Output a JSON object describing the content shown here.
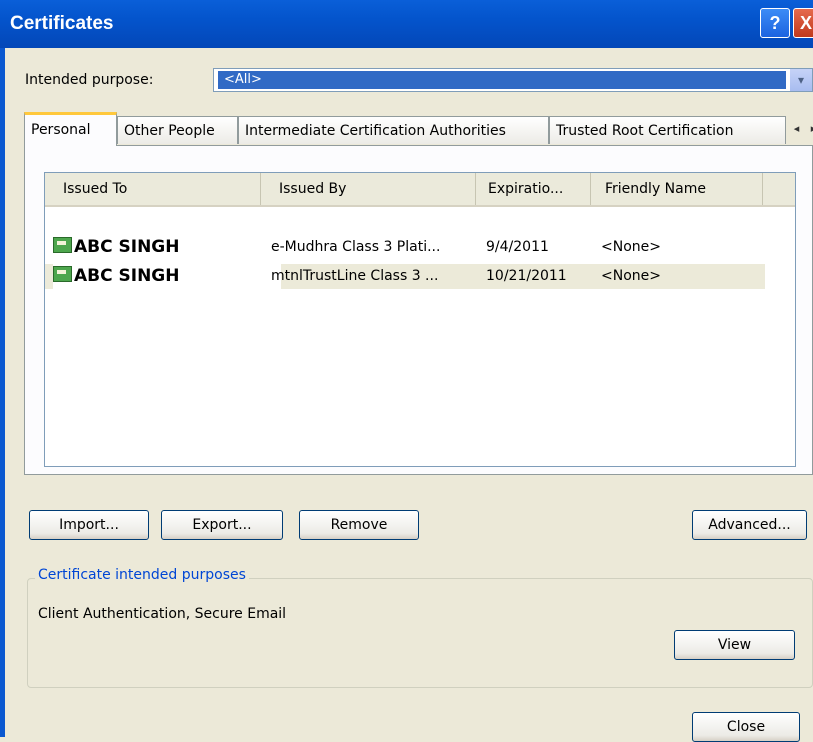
{
  "window": {
    "title": "Certificates",
    "help_label": "?",
    "close_label": "X"
  },
  "purpose": {
    "label": "Intended purpose:",
    "value": "<All>",
    "arrow": "▾"
  },
  "tabs": [
    {
      "label": "Personal"
    },
    {
      "label": "Other People"
    },
    {
      "label": "Intermediate Certification Authorities"
    },
    {
      "label": "Trusted Root Certification"
    }
  ],
  "tab_scroll": "◂ ▸",
  "columns": [
    "Issued To",
    "Issued By",
    "Expiratio...",
    "Friendly Name"
  ],
  "rows": [
    {
      "issued_to": "ABC SINGH",
      "issued_by": "e-Mudhra Class 3 Plati...",
      "expiration": "9/4/2011",
      "friendly_name": "<None>"
    },
    {
      "issued_to": "ABC SINGH",
      "issued_by": "mtnlTrustLine Class 3 ...",
      "expiration": "10/21/2011",
      "friendly_name": "<None>"
    }
  ],
  "buttons": {
    "import": "Import...",
    "export": "Export...",
    "remove": "Remove",
    "advanced": "Advanced...",
    "view": "View",
    "close": "Close"
  },
  "purposes_group": {
    "title": "Certificate intended purposes",
    "text": "Client Authentication, Secure Email"
  },
  "colors": {
    "titlebar": "#0454cc",
    "selection": "#316ac5",
    "active_tab": "#ffc83c"
  }
}
